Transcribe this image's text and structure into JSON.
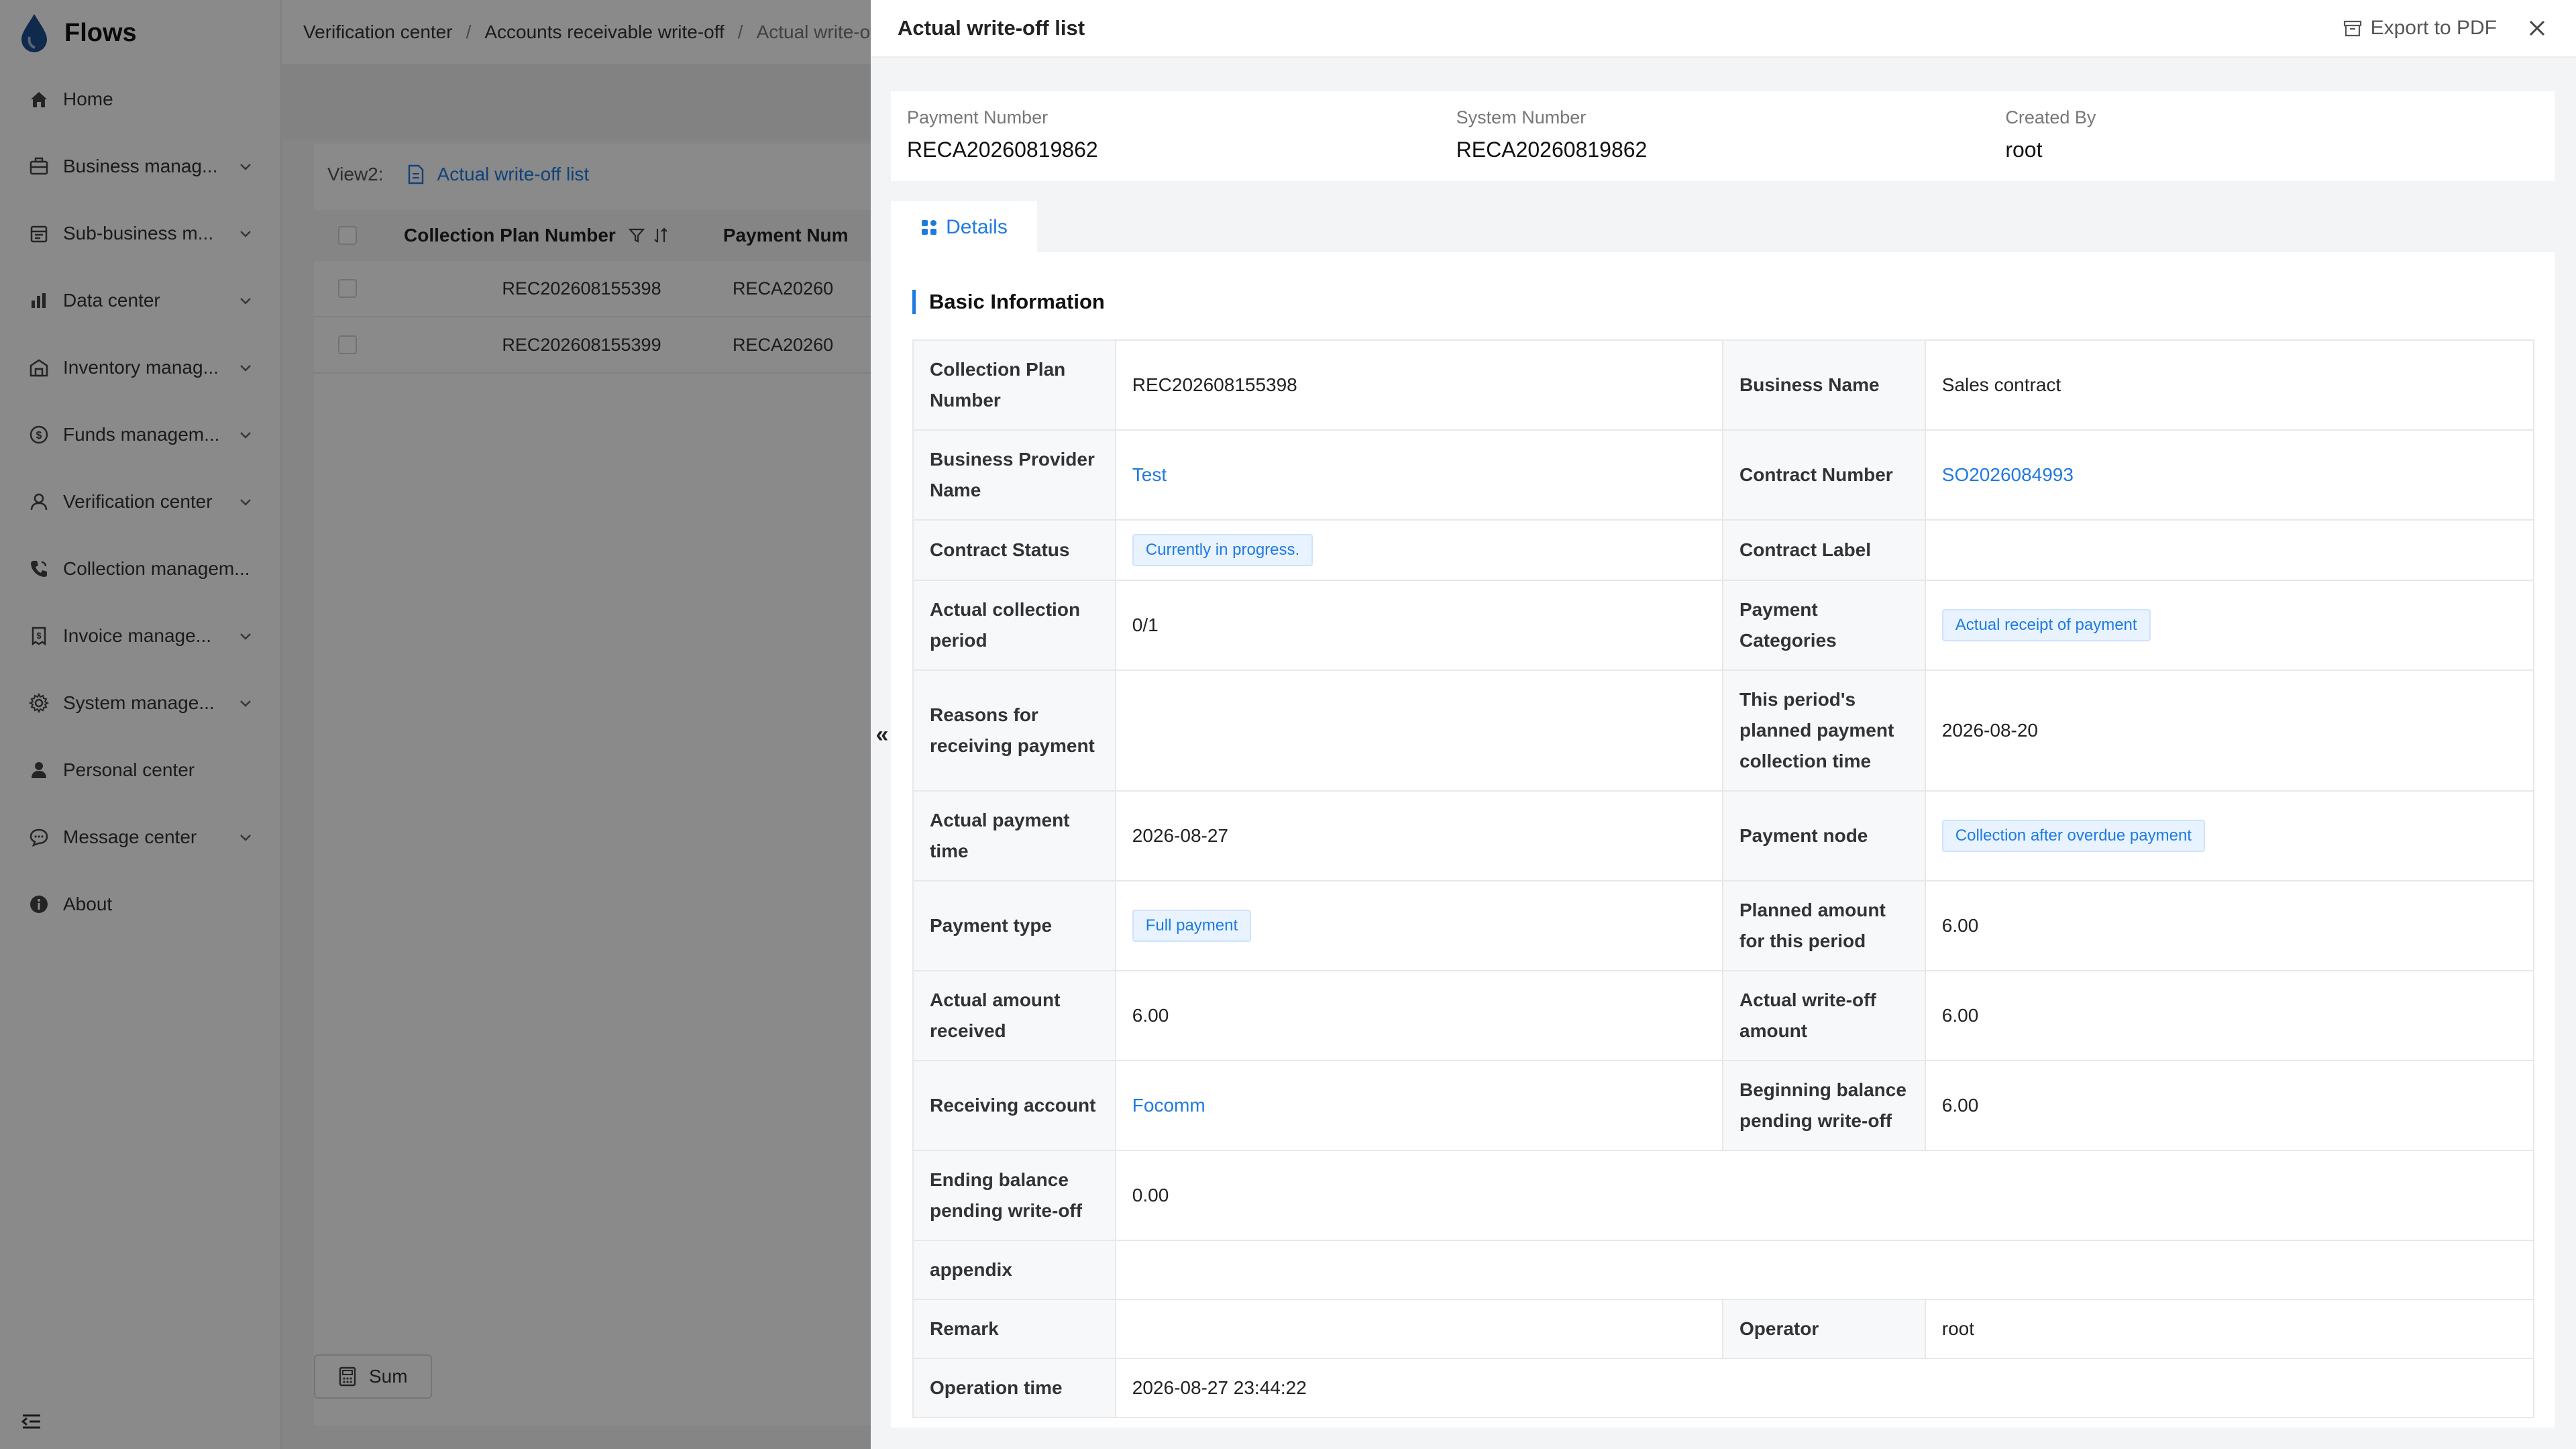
{
  "app": {
    "name": "Flows"
  },
  "sidebar": {
    "items": [
      {
        "label": "Home",
        "icon": "home-icon",
        "has_chevron": false
      },
      {
        "label": "Business manag...",
        "icon": "briefcase-icon",
        "has_chevron": true
      },
      {
        "label": "Sub-business m...",
        "icon": "calendar-icon",
        "has_chevron": true
      },
      {
        "label": "Data center",
        "icon": "bar-chart-icon",
        "has_chevron": true
      },
      {
        "label": "Inventory manag...",
        "icon": "warehouse-icon",
        "has_chevron": true
      },
      {
        "label": "Funds managem...",
        "icon": "coin-icon",
        "has_chevron": true
      },
      {
        "label": "Verification center",
        "icon": "user-check-icon",
        "has_chevron": true
      },
      {
        "label": "Collection managem...",
        "icon": "phone-icon",
        "has_chevron": false
      },
      {
        "label": "Invoice manage...",
        "icon": "invoice-icon",
        "has_chevron": true
      },
      {
        "label": "System manage...",
        "icon": "gear-icon",
        "has_chevron": true
      },
      {
        "label": "Personal center",
        "icon": "person-icon",
        "has_chevron": false
      },
      {
        "label": "Message center",
        "icon": "message-icon",
        "has_chevron": true
      },
      {
        "label": "About",
        "icon": "info-icon",
        "has_chevron": false
      }
    ]
  },
  "breadcrumb": {
    "items": [
      "Verification center",
      "Accounts receivable write-off",
      "Actual write-of"
    ]
  },
  "list": {
    "view_label": "View2:",
    "view_name": "Actual write-off list",
    "columns": [
      "Collection Plan Number",
      "Payment Num"
    ],
    "rows": [
      {
        "plan": "REC202608155398",
        "payment": "RECA20260"
      },
      {
        "plan": "REC202608155399",
        "payment": "RECA20260"
      }
    ],
    "sum_label": "Sum"
  },
  "drawer": {
    "title": "Actual write-off list",
    "export_label": "Export to PDF",
    "toggle_glyph": "«",
    "summary": [
      {
        "label": "Payment Number",
        "value": "RECA20260819862"
      },
      {
        "label": "System Number",
        "value": "RECA20260819862"
      },
      {
        "label": "Created By",
        "value": "root"
      }
    ],
    "tab_label": "Details",
    "section_title": "Basic Information",
    "fields": {
      "collection_plan_number": {
        "label": "Collection Plan Number",
        "value": "REC202608155398"
      },
      "business_name": {
        "label": "Business Name",
        "value": "Sales contract"
      },
      "business_provider_name": {
        "label": "Business Provider Name",
        "value": "Test"
      },
      "contract_number": {
        "label": "Contract Number",
        "value": "SO2026084993"
      },
      "contract_status": {
        "label": "Contract Status",
        "value": "Currently in progress."
      },
      "contract_label": {
        "label": "Contract Label",
        "value": ""
      },
      "actual_collection_period": {
        "label": "Actual collection period",
        "value": "0/1"
      },
      "payment_categories": {
        "label": "Payment Categories",
        "value": "Actual receipt of payment"
      },
      "reasons_for_receiving": {
        "label": "Reasons for receiving payment",
        "value": ""
      },
      "planned_collection_time": {
        "label": "This period's planned payment collection time",
        "value": "2026-08-20"
      },
      "actual_payment_time": {
        "label": "Actual payment time",
        "value": "2026-08-27"
      },
      "payment_node": {
        "label": "Payment node",
        "value": "Collection after overdue payment"
      },
      "payment_type": {
        "label": "Payment type",
        "value": "Full payment"
      },
      "planned_amount": {
        "label": "Planned amount for this period",
        "value": "6.00"
      },
      "actual_amount_received": {
        "label": "Actual amount received",
        "value": "6.00"
      },
      "actual_writeoff_amount": {
        "label": "Actual write-off amount",
        "value": "6.00"
      },
      "receiving_account": {
        "label": "Receiving account",
        "value": "Focomm"
      },
      "beginning_balance": {
        "label": "Beginning balance pending write-off",
        "value": "6.00"
      },
      "ending_balance": {
        "label": "Ending balance pending write-off",
        "value": "0.00"
      },
      "appendix": {
        "label": "appendix",
        "value": ""
      },
      "remark": {
        "label": "Remark",
        "value": ""
      },
      "operator": {
        "label": "Operator",
        "value": "root"
      },
      "operation_time": {
        "label": "Operation time",
        "value": "2026-08-27 23:44:22"
      }
    }
  },
  "colors": {
    "accent": "#1f7ae0",
    "tag_bg": "#e8f3ff",
    "overlay": "rgba(0,0,0,0.46)"
  }
}
